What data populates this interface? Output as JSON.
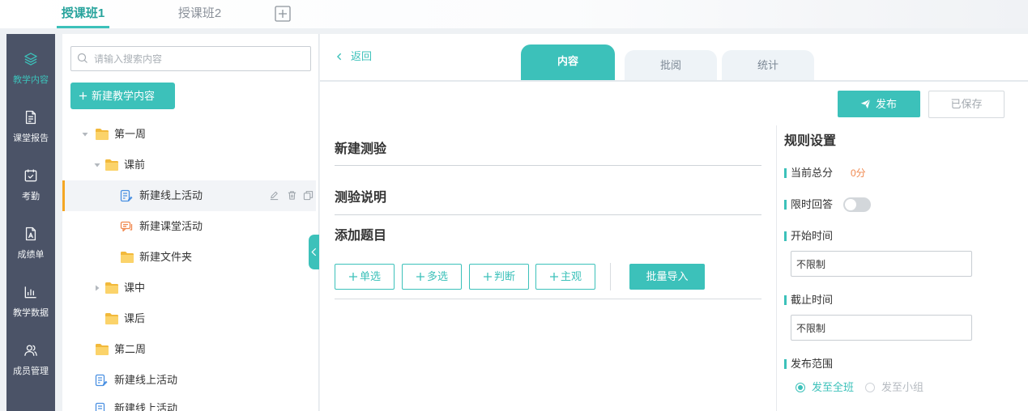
{
  "colors": {
    "accent": "#3cc1ba",
    "sidebar_bg": "#4b5367",
    "selected_marker": "#f5a623",
    "score": "#f0884e"
  },
  "class_tabs": [
    {
      "label": "授课班1",
      "active": true
    },
    {
      "label": "授课班2",
      "active": false
    }
  ],
  "sidebar": {
    "items": [
      {
        "label": "教学内容",
        "icon": "layers-icon",
        "active": true
      },
      {
        "label": "课堂报告",
        "icon": "report-icon",
        "active": false
      },
      {
        "label": "考勤",
        "icon": "attendance-icon",
        "active": false
      },
      {
        "label": "成绩单",
        "icon": "grade-sheet-icon",
        "active": false
      },
      {
        "label": "教学数据",
        "icon": "bar-chart-icon",
        "active": false
      },
      {
        "label": "成员管理",
        "icon": "members-icon",
        "active": false
      }
    ]
  },
  "tree": {
    "search_placeholder": "请输入搜索内容",
    "new_button_label": "新建教学内容",
    "nodes": [
      {
        "label": "第一周",
        "type": "folder",
        "level": 0,
        "expanded": true
      },
      {
        "label": "课前",
        "type": "folder",
        "level": 1,
        "expanded": true
      },
      {
        "label": "新建线上活动",
        "type": "online-activity",
        "level": 2,
        "selected": true
      },
      {
        "label": "新建课堂活动",
        "type": "class-activity",
        "level": 2
      },
      {
        "label": "新建文件夹",
        "type": "folder",
        "level": 2
      },
      {
        "label": "课中",
        "type": "folder",
        "level": 1,
        "expanded": false
      },
      {
        "label": "课后",
        "type": "folder",
        "level": 1
      },
      {
        "label": "第二周",
        "type": "folder",
        "level": 0
      },
      {
        "label": "新建线上活动",
        "type": "online-activity",
        "level": 0
      },
      {
        "label": "新建线上活动",
        "type": "online-activity",
        "level": 0
      }
    ]
  },
  "editor": {
    "back_label": "返回",
    "tabs": [
      {
        "label": "内容",
        "active": true
      },
      {
        "label": "批阅",
        "active": false
      },
      {
        "label": "统计",
        "active": false
      }
    ],
    "publish_label": "发布",
    "saved_label": "已保存",
    "quiz_title": "新建测验",
    "quiz_description": "测验说明",
    "add_questions_heading": "添加题目",
    "question_types": [
      {
        "label": "单选"
      },
      {
        "label": "多选"
      },
      {
        "label": "判断"
      },
      {
        "label": "主观"
      }
    ],
    "batch_import_label": "批量导入"
  },
  "rules": {
    "title": "规则设置",
    "total_score": {
      "label": "当前总分",
      "value": "0分"
    },
    "time_limit": {
      "label": "限时回答",
      "enabled": false
    },
    "start_time": {
      "label": "开始时间",
      "value": "不限制"
    },
    "end_time": {
      "label": "截止时间",
      "value": "不限制"
    },
    "scope": {
      "label": "发布范围",
      "options": [
        {
          "label": "发至全班",
          "selected": true,
          "disabled": false
        },
        {
          "label": "发至小组",
          "selected": false,
          "disabled": true
        }
      ]
    }
  }
}
